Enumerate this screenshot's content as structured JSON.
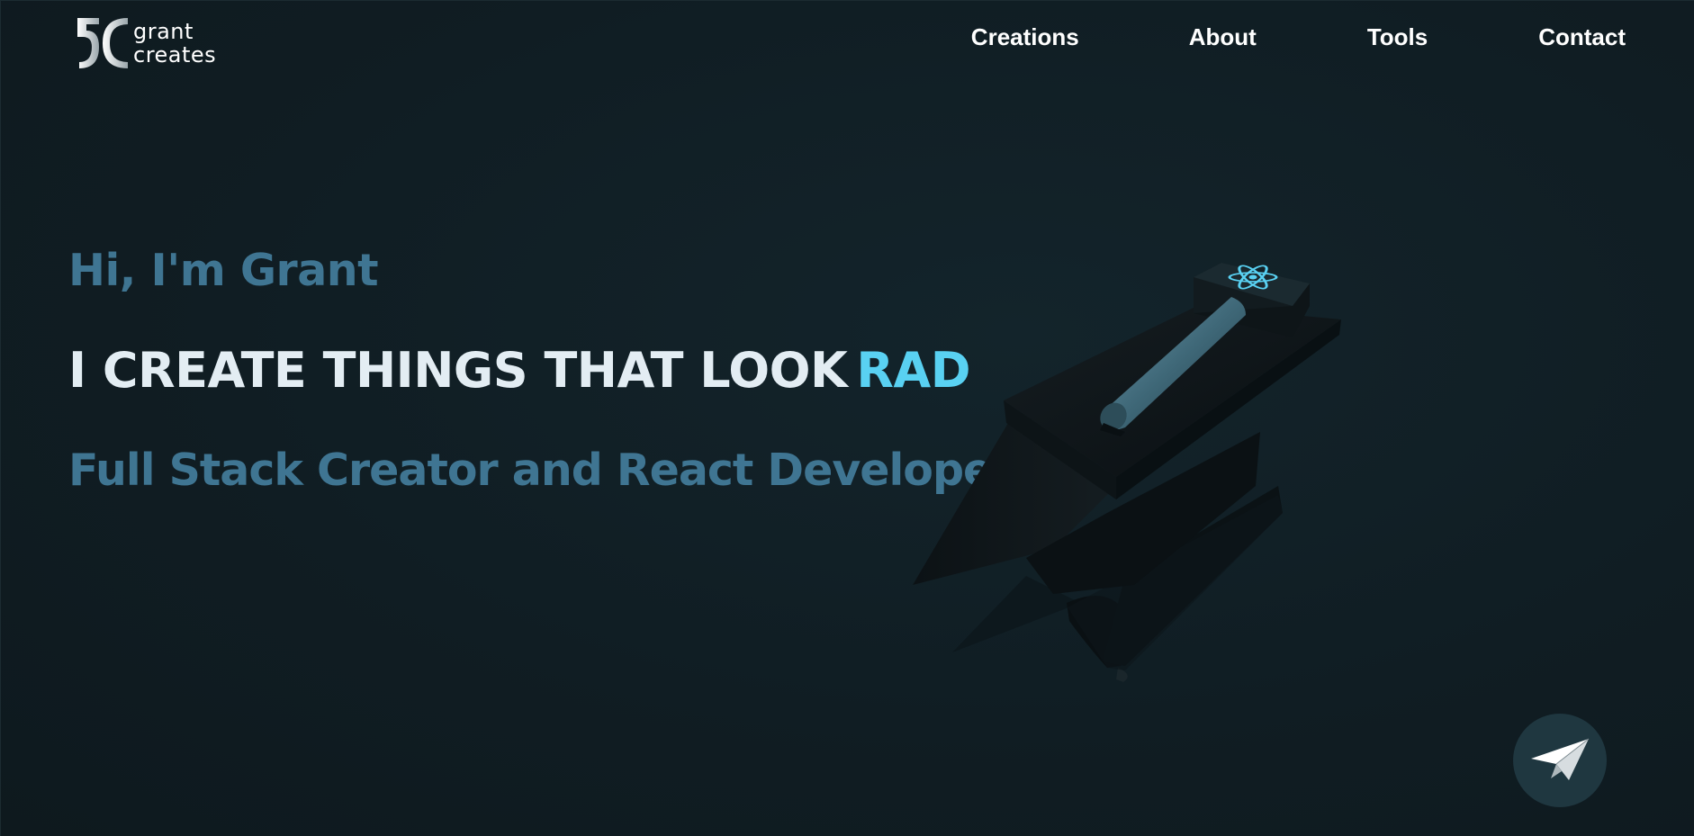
{
  "header": {
    "logo": {
      "line1": "grant",
      "line2": "creates",
      "icon": "gc-monogram-icon"
    },
    "nav": [
      {
        "label": "Creations"
      },
      {
        "label": "About"
      },
      {
        "label": "Tools"
      },
      {
        "label": "Contact"
      }
    ]
  },
  "hero": {
    "greeting": "Hi, I'm Grant",
    "headline": "I CREATE THINGS THAT LOOK",
    "headline_accent": "RAD",
    "subtitle": "Full Stack Creator and React Developer",
    "illustration": "anvil-hammer-icon",
    "hammer_emblem": "react-atom-icon"
  },
  "fab": {
    "icon": "paper-plane-icon"
  },
  "colors": {
    "background": "#101d23",
    "accent": "#59d1f2",
    "muted": "#3f7592",
    "headline": "#e3edf3",
    "fab_background": "#1f3740"
  }
}
